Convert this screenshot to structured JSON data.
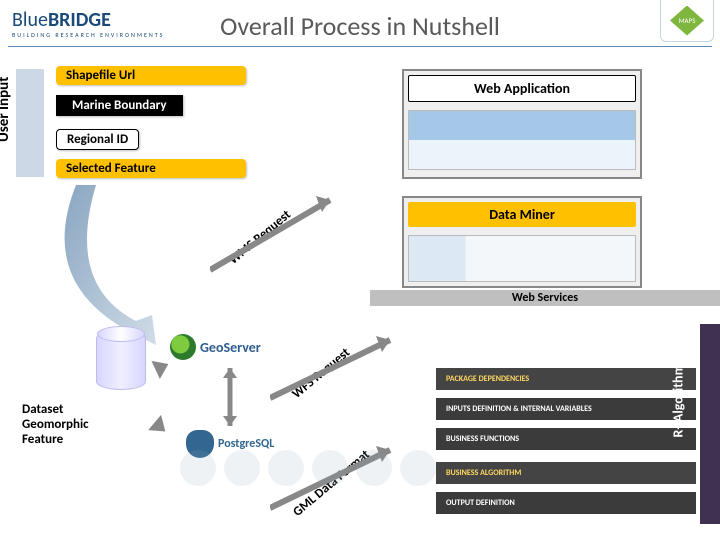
{
  "header": {
    "logo_part1": "Blue",
    "logo_part2": "BRIDGE",
    "logo_sub": "BUILDING RESEARCH ENVIRONMENTS",
    "title": "Overall Process in Nutshell",
    "corner_icon_name": "maps-diamond-icon",
    "corner_text": "MAPS"
  },
  "user_input": {
    "label": "User Input",
    "items": [
      "Shapefile Url",
      "Marine Boundary",
      "Regional ID",
      "Selected Feature"
    ]
  },
  "apps": {
    "web_app": "Web Application",
    "data_miner": "Data Miner"
  },
  "services_strip": "Web Services",
  "arrows": {
    "wms": "WMS Request",
    "wfs": "WFS Request",
    "gml": "GML Data Format"
  },
  "dataset": {
    "label": "Dataset Geomorphic Feature",
    "geoserver": "GeoServer",
    "postgres": "PostgreSQL"
  },
  "packages": [
    "PACKAGE DEPENDENCIES",
    "INPUTS DEFINITION & INTERNAL VARIABLES",
    "BUSINESS FUNCTIONS",
    "BUSINESS ALGORITHM",
    "OUTPUT DEFINITION"
  ],
  "ralgorithm": "R- Algorithm",
  "colors": {
    "pill": "#ffc000",
    "strip": "#bfbfbf",
    "package": "#3b3b3b",
    "ralg": "#403151"
  }
}
